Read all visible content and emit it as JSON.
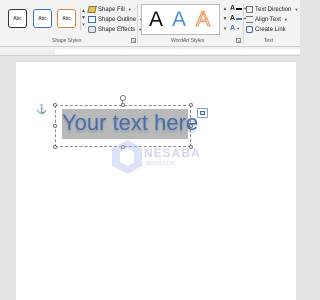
{
  "shape_styles": {
    "presets": [
      "Abc",
      "Abc",
      "Abc"
    ],
    "shape_fill": "Shape Fill",
    "shape_outline": "Shape Outline",
    "shape_effects": "Shape Effects",
    "group_label": "Shape Styles"
  },
  "wordart_styles": {
    "samples": [
      "A",
      "A",
      "A"
    ],
    "group_label": "WordArt Styles"
  },
  "text_group": {
    "text_direction": "Text Direction",
    "align_text": "Align Text",
    "create_link": "Create Link",
    "group_label": "Text"
  },
  "document": {
    "textbox_text": "Your text here"
  },
  "watermark": {
    "text": "NESABA",
    "sub": "MEDIA.COM"
  },
  "colors": {
    "accent_blue": "#3a6cc1",
    "wordart_text": "#4a6ea8",
    "text_highlight": "#b9b9b9"
  }
}
